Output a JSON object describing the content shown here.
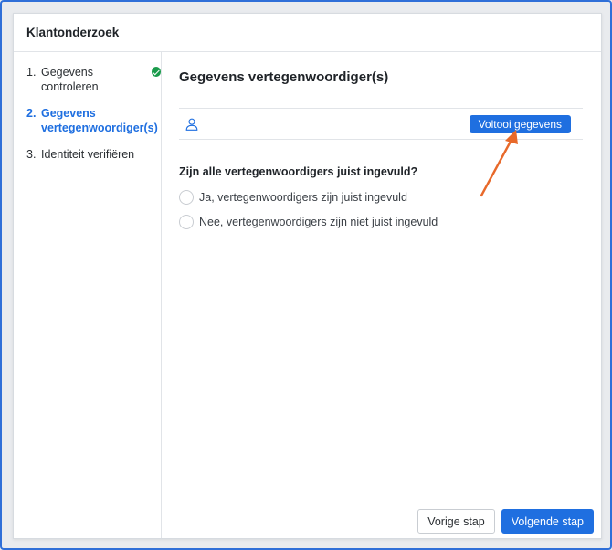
{
  "dialog": {
    "title": "Klantonderzoek"
  },
  "sidebar": {
    "steps": [
      {
        "number": "1.",
        "label": "Gegevens controleren",
        "completed": true
      },
      {
        "number": "2.",
        "label": "Gegevens vertegenwoordiger(s)",
        "active": true
      },
      {
        "number": "3.",
        "label": "Identiteit verifiëren"
      }
    ]
  },
  "main": {
    "title": "Gegevens vertegenwoordiger(s)",
    "representative_icon": "user-icon",
    "complete_button": "Voltooi gegevens",
    "question": "Zijn alle vertegenwoordigers juist ingevuld?",
    "options": [
      {
        "label": "Ja, vertegenwoordigers zijn juist ingevuld",
        "selected": false
      },
      {
        "label": "Nee, vertegenwoordigers zijn niet juist ingevuld",
        "selected": false
      }
    ]
  },
  "footer": {
    "previous": "Vorige stap",
    "next": "Volgende stap"
  },
  "colors": {
    "accent": "#1f6fe0",
    "success": "#1a9b4b",
    "annotation_arrow": "#e8692a",
    "frame": "#2f6fd8"
  }
}
